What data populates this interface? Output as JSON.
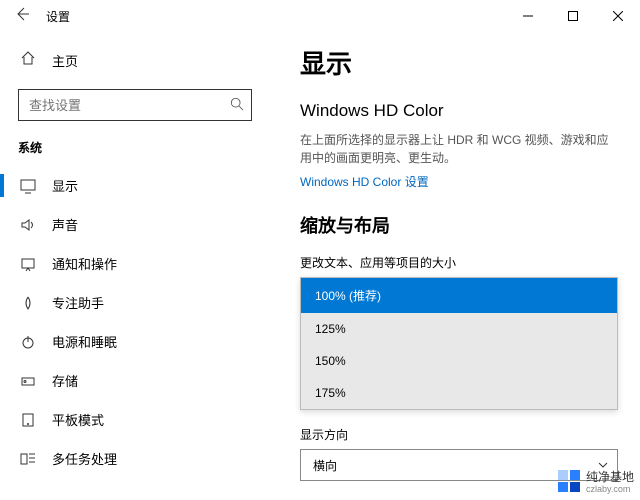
{
  "window": {
    "title": "设置"
  },
  "sidebar": {
    "home": "主页",
    "search_placeholder": "查找设置",
    "section": "系统",
    "items": [
      {
        "label": "显示"
      },
      {
        "label": "声音"
      },
      {
        "label": "通知和操作"
      },
      {
        "label": "专注助手"
      },
      {
        "label": "电源和睡眠"
      },
      {
        "label": "存储"
      },
      {
        "label": "平板模式"
      },
      {
        "label": "多任务处理"
      }
    ]
  },
  "main": {
    "title": "显示",
    "hd_title": "Windows HD Color",
    "hd_desc": "在上面所选择的显示器上让 HDR 和 WCG 视频、游戏和应用中的画面更明亮、更生动。",
    "hd_link": "Windows HD Color 设置",
    "scale_section": "缩放与布局",
    "scale_label": "更改文本、应用等项目的大小",
    "scale_options": [
      "100% (推荐)",
      "125%",
      "150%",
      "175%"
    ],
    "orientation_label": "显示方向",
    "orientation_value": "横向"
  },
  "watermark": {
    "name": "纯净基地",
    "url": "czlaby.com"
  }
}
